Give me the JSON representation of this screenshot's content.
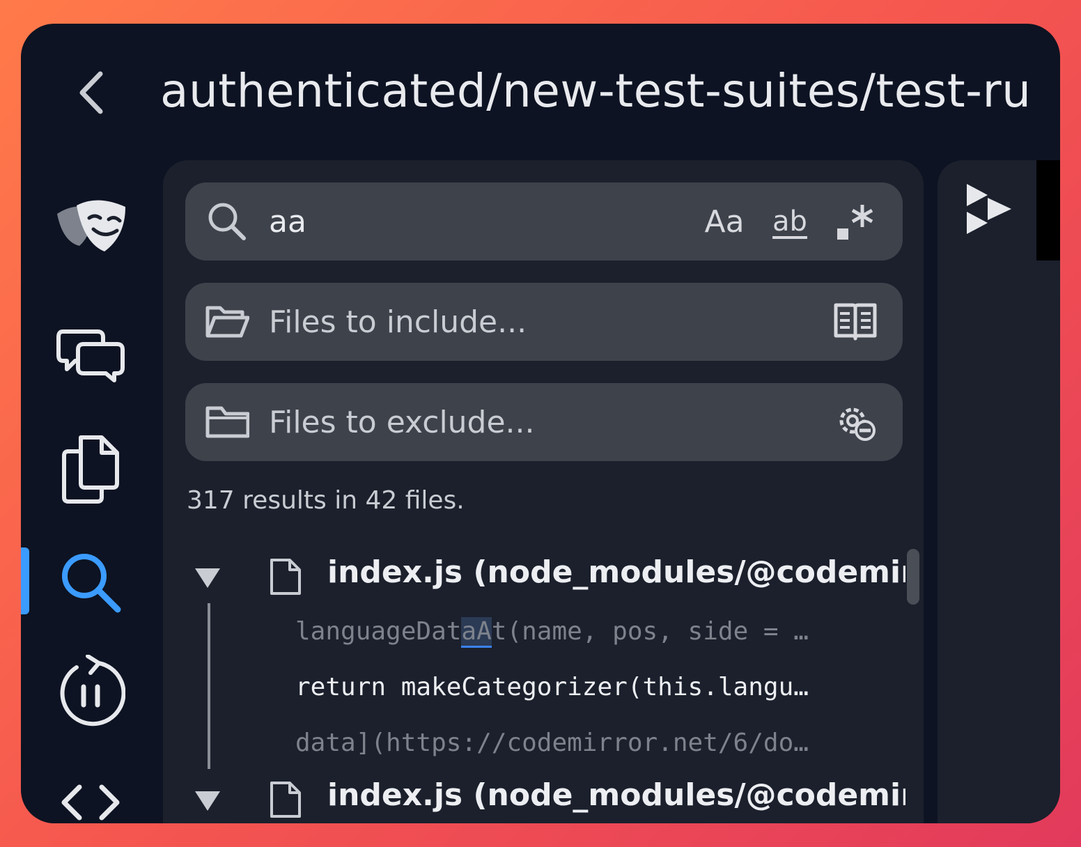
{
  "window": {
    "breadcrumb": "authenticated/new-test-suites/test-ru",
    "back_label": "back"
  },
  "activity_bar": {
    "items": [
      {
        "name": "playwright"
      },
      {
        "name": "discussions"
      },
      {
        "name": "explorer"
      },
      {
        "name": "search",
        "active": true
      },
      {
        "name": "timeline"
      },
      {
        "name": "source-code"
      }
    ],
    "accent_color": "#3b9bff"
  },
  "search": {
    "query": "aa",
    "match_case_label": "Aa",
    "whole_word_label": "ab",
    "regex_label": ".*",
    "include_placeholder": "Files to include...",
    "exclude_placeholder": "Files to exclude...",
    "summary": "317 results in 42 files."
  },
  "results": [
    {
      "file": "index.js (node_modules/@codemirr",
      "matches": [
        {
          "before": "languageDat",
          "match": "aA",
          "after": "t(name, pos, side = …",
          "style": "dim"
        },
        {
          "text": "return makeCategorizer(this.langu…",
          "style": "bright"
        },
        {
          "text": "data](https://codemirror.net/6/do…",
          "style": "dim"
        }
      ]
    },
    {
      "file": "index.js (node_modules/@codemirr",
      "matches": []
    }
  ]
}
